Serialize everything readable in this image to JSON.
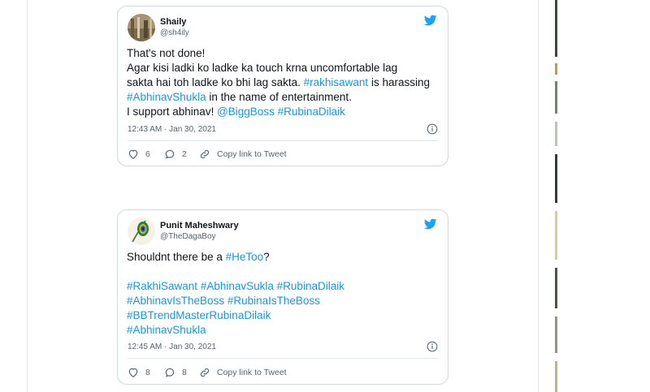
{
  "tweets": [
    {
      "name": "Shaily",
      "handle": "@sh4ily",
      "lines": [
        [
          {
            "t": "That's not done!"
          }
        ],
        [
          {
            "t": "Agar kisi ladki ko ladke ka touch krna uncomfortable lag"
          }
        ],
        [
          {
            "t": "sakta hai toh ladke ko bhi lag sakta. "
          },
          {
            "t": "#rakhisawant",
            "tag": true
          },
          {
            "t": " is harassing"
          }
        ],
        [
          {
            "t": "#AbhinavShukla",
            "tag": true
          },
          {
            "t": " in the name of entertainment."
          }
        ],
        [
          {
            "t": "I support abhinav! "
          },
          {
            "t": "@BiggBoss",
            "tag": true
          },
          {
            "t": " "
          },
          {
            "t": "#RubinaDilaik",
            "tag": true
          }
        ]
      ],
      "timestamp": "12:43 AM · Jan 30, 2021",
      "likes": "6",
      "replies": "2",
      "copy_label": "Copy link to Tweet"
    },
    {
      "name": "Punit Maheshwary",
      "handle": "@TheDagaBoy",
      "lines": [
        [
          {
            "t": "Shouldnt there be a "
          },
          {
            "t": "#HeToo",
            "tag": true
          },
          {
            "t": "?"
          }
        ],
        [
          {
            "t": " "
          }
        ],
        [
          {
            "t": "#RakhiSawant",
            "tag": true
          },
          {
            "t": " "
          },
          {
            "t": "#AbhinavSukla",
            "tag": true
          },
          {
            "t": " "
          },
          {
            "t": "#RubinaDilaik",
            "tag": true
          }
        ],
        [
          {
            "t": "#AbhinavIsTheBoss",
            "tag": true
          },
          {
            "t": " "
          },
          {
            "t": "#RubinaIsTheBoss",
            "tag": true
          }
        ],
        [
          {
            "t": "#BBTrendMasterRubinaDilaik",
            "tag": true
          }
        ],
        [
          {
            "t": "#AbhinavShukla",
            "tag": true
          }
        ]
      ],
      "timestamp": "12:45 AM · Jan 30, 2021",
      "likes": "8",
      "replies": "8",
      "copy_label": "Copy link to Tweet"
    }
  ],
  "icons": {
    "brand": "twitter-bird-icon",
    "like": "heart-icon",
    "reply": "reply-bubble-icon",
    "copy": "link-icon",
    "info": "info-icon"
  },
  "colors": {
    "twitter_blue": "#1da1f2",
    "hashtag": "#1b95e0",
    "border": "#cfd9de",
    "muted_text": "#536471"
  }
}
